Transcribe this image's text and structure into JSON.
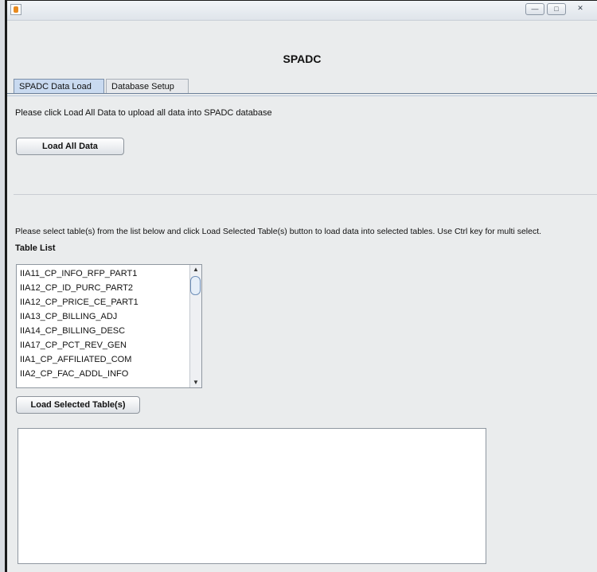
{
  "window": {
    "controls": {
      "minimize": "—",
      "maximize": "□",
      "close": "✕"
    }
  },
  "app": {
    "title": "SPADC"
  },
  "tabs": [
    {
      "label": "SPADC Data Load",
      "active": true
    },
    {
      "label": "Database Setup",
      "active": false
    }
  ],
  "load_all": {
    "instruction": "Please click Load All Data to upload all data into SPADC database",
    "button_label": "Load All Data"
  },
  "tables": {
    "instruction": "Please select table(s) from the list below and click Load Selected Table(s) button to load data into selected tables. Use Ctrl key for multi select.",
    "heading": "Table List",
    "items": [
      "IIA11_CP_INFO_RFP_PART1",
      "IIA12_CP_ID_PURC_PART2",
      "IIA12_CP_PRICE_CE_PART1",
      "IIA13_CP_BILLING_ADJ",
      "IIA14_CP_BILLING_DESC",
      "IIA17_CP_PCT_REV_GEN",
      "IIA1_CP_AFFILIATED_COM",
      "IIA2_CP_FAC_ADDL_INFO"
    ],
    "button_label": "Load Selected Table(s)"
  },
  "icons": {
    "scroll_up": "▲",
    "scroll_down": "▼"
  }
}
